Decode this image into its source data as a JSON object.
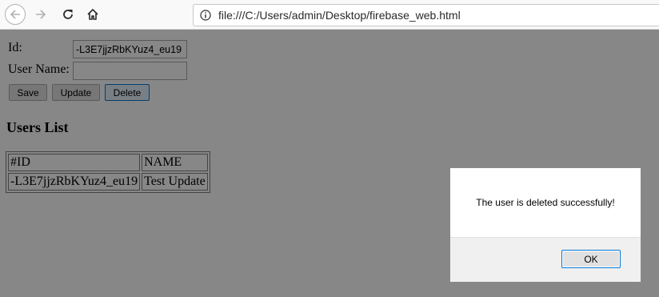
{
  "browser": {
    "url": "file:///C:/Users/admin/Desktop/firebase_web.html",
    "icons": {
      "back": "back-arrow-icon",
      "forward": "forward-arrow-icon",
      "reload": "reload-icon",
      "home": "home-icon",
      "info": "info-icon"
    }
  },
  "form": {
    "id_label": "Id:",
    "id_value": "-L3E7jjzRbKYuz4_eu19",
    "name_label": "User Name:",
    "name_value": "",
    "save_label": "Save",
    "update_label": "Update",
    "delete_label": "Delete"
  },
  "users": {
    "title": "Users List",
    "columns": [
      "#ID",
      "NAME"
    ],
    "rows": [
      [
        "-L3E7jjzRbKYuz4_eu19",
        "Test Update"
      ]
    ]
  },
  "dialog": {
    "message": "The user is deleted successfully!",
    "ok_label": "OK"
  },
  "colors": {
    "overlay": "#000000",
    "focus_accent": "#0078d7"
  }
}
